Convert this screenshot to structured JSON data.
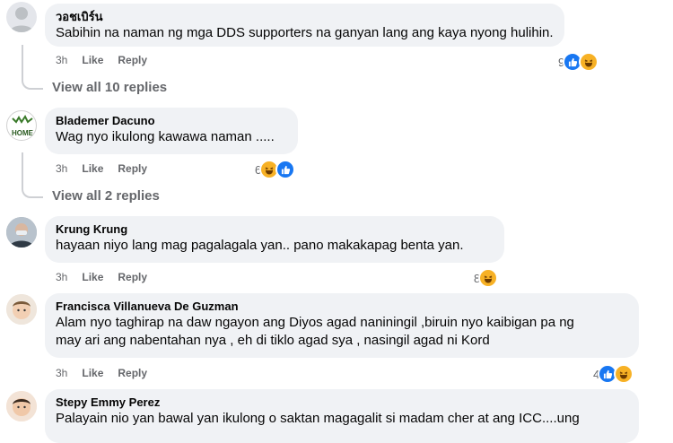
{
  "comments": [
    {
      "author": "วอชเบิร์น",
      "text": "Sabihin na naman ng mga DDS supporters na ganyan lang ang kaya nyong hulihin.",
      "time": "3h",
      "like": "Like",
      "reply": "Reply",
      "reaction_count": "9",
      "reactions": [
        "like-icon",
        "haha-icon"
      ]
    },
    {
      "author": "Blademer Dacuno",
      "text": "Wag nyo ikulong kawawa naman .....",
      "time": "3h",
      "like": "Like",
      "reply": "Reply",
      "reaction_count": "6",
      "reactions": [
        "haha-icon",
        "like-icon"
      ],
      "avatar_text": "HOME"
    },
    {
      "author": "Krung Krung",
      "text": "hayaan niyo lang mag pagalagala yan.. pano makakapag benta yan.",
      "time": "3h",
      "like": "Like",
      "reply": "Reply",
      "reaction_count": "8",
      "reactions": [
        "haha-icon"
      ]
    },
    {
      "author": "Francisca Villanueva De Guzman",
      "text_line1": "Alam nyo taghirap na daw ngayon ang Diyos agad naniningil ,biruin nyo kaibigan pa ng",
      "text_line2": "may ari ang nabentahan nya , eh di tiklo agad sya , nasingil agad ni Kord",
      "time": "3h",
      "like": "Like",
      "reply": "Reply",
      "reaction_count": "4",
      "reactions": [
        "like-icon",
        "haha-icon"
      ]
    },
    {
      "author": "Stepy Emmy Perez",
      "text": "Palayain nio yan bawal yan ikulong o saktan magagalit si madam cher at ang ICC....ung"
    }
  ],
  "view_replies": [
    "View all 10 replies",
    "View all 2 replies"
  ],
  "colors": {
    "bubble": "#f0f2f5",
    "muted": "#65676b",
    "like": "#1877f2",
    "haha": "#f7b125"
  }
}
